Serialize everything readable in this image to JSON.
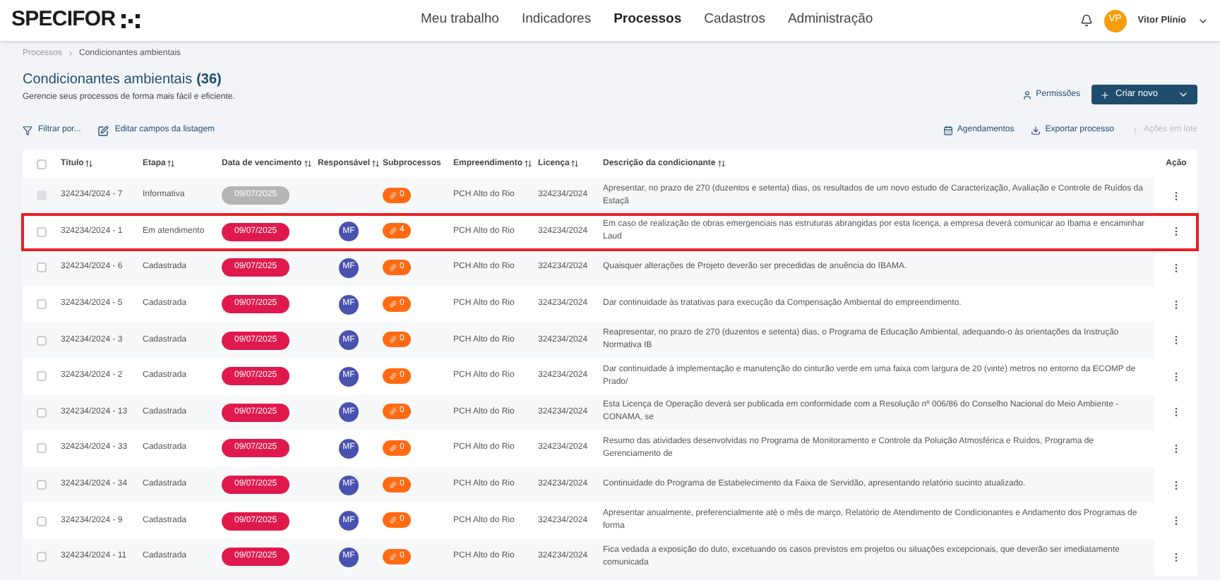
{
  "header": {
    "logo": "SPECIFOR",
    "nav": [
      {
        "label": "Meu trabalho",
        "selected": false
      },
      {
        "label": "Indicadores",
        "selected": false
      },
      {
        "label": "Processos",
        "selected": true
      },
      {
        "label": "Cadastros",
        "selected": false
      },
      {
        "label": "Administração",
        "selected": false
      }
    ],
    "user": {
      "initials": "VP",
      "name": "Vitor Plínio"
    }
  },
  "breadcrumb": [
    "Processos",
    "Condicionantes ambientais"
  ],
  "page": {
    "title": "Condicionantes ambientais",
    "count": "(36)",
    "subtitle": "Gerencie seus processos de forma mais fácil e eficiente.",
    "permissions": "Permissões",
    "create": "Criar novo"
  },
  "toolbar": {
    "left": [
      "Filtrar por...",
      "Editar campos da listagem"
    ],
    "right": [
      {
        "label": "Agendamentos",
        "disabled": false
      },
      {
        "label": "Exportar processo",
        "disabled": false
      },
      {
        "label": "Ações em lote",
        "disabled": true
      }
    ]
  },
  "table": {
    "select_all_checked": false,
    "columns": [
      {
        "label": "Título",
        "sortable": true
      },
      {
        "label": "Etapa",
        "sortable": true
      },
      {
        "label": "Data de vencimento",
        "sortable": true
      },
      {
        "label": "Responsável",
        "sortable": true
      },
      {
        "label": "Subprocessos",
        "sortable": false
      },
      {
        "label": "Empreendimento",
        "sortable": true
      },
      {
        "label": "Licença",
        "sortable": true
      },
      {
        "label": "Descrição da condicionante",
        "sortable": true
      },
      {
        "label": "Ação",
        "sortable": false
      }
    ],
    "rows": [
      {
        "title": "324234/2024 - 7",
        "stage": "Informativa",
        "due": "09/07/2025",
        "overdue": false,
        "disabled": true,
        "highlighted": false,
        "subprocesses": "0",
        "project": "PCH Alto do Rio",
        "license": "324234/2024",
        "description": "Apresentar, no prazo de 270 (duzentos e setenta) dias, os resultados de um novo estudo de Caracterização, Avaliação e Controle de Ruídos da Estaçã"
      },
      {
        "title": "324234/2024 - 1",
        "stage": "Em atendimento",
        "due": "09/07/2025",
        "overdue": true,
        "disabled": false,
        "highlighted": true,
        "owner": "MF",
        "subprocesses": "4",
        "project": "PCH Alto do Rio",
        "license": "324234/2024",
        "description": "Em caso de realização de obras emergenciais nas estruturas abrangidas por esta licença, a empresa deverá comunicar ao Ibama e encaminhar Laud"
      },
      {
        "title": "324234/2024 - 6",
        "stage": "Cadastrada",
        "due": "09/07/2025",
        "overdue": true,
        "disabled": false,
        "highlighted": false,
        "owner": "MF",
        "subprocesses": "0",
        "project": "PCH Alto do Rio",
        "license": "324234/2024",
        "description": "Quaisquer alterações de Projeto deverão ser precedidas de anuência do IBAMA."
      },
      {
        "title": "324234/2024 - 5",
        "stage": "Cadastrada",
        "due": "09/07/2025",
        "overdue": true,
        "disabled": false,
        "highlighted": false,
        "owner": "MF",
        "subprocesses": "0",
        "project": "PCH Alto do Rio",
        "license": "324234/2024",
        "description": "Dar continuidade às tratativas para execução da Compensação Ambiental do empreendimento."
      },
      {
        "title": "324234/2024 - 3",
        "stage": "Cadastrada",
        "due": "09/07/2025",
        "overdue": true,
        "disabled": false,
        "highlighted": false,
        "owner": "MF",
        "subprocesses": "0",
        "project": "PCH Alto do Rio",
        "license": "324234/2024",
        "description": "Reapresentar, no prazo de 270 (duzentos e setenta) dias, o Programa de Educação Ambiental, adequando-o às orientações da Instrução Normativa IB"
      },
      {
        "title": "324234/2024 - 2",
        "stage": "Cadastrada",
        "due": "09/07/2025",
        "overdue": true,
        "disabled": false,
        "highlighted": false,
        "owner": "MF",
        "subprocesses": "0",
        "project": "PCH Alto do Rio",
        "license": "324234/2024",
        "description": "Dar continuidade à implementação e manutenção do cinturão verde em uma faixa com largura de 20 (vinte) metros no entorno da ECOMP de Prado/"
      },
      {
        "title": "324234/2024 - 13",
        "stage": "Cadastrada",
        "due": "09/07/2025",
        "overdue": true,
        "disabled": false,
        "highlighted": false,
        "owner": "MF",
        "subprocesses": "0",
        "project": "PCH Alto do Rio",
        "license": "324234/2024",
        "description": "Esta Licença de Operação deverá ser publicada em conformidade com a Resolução nº 006/86 do Conselho Nacional do Meio Ambiente - CONAMA, se"
      },
      {
        "title": "324234/2024 - 33",
        "stage": "Cadastrada",
        "due": "09/07/2025",
        "overdue": true,
        "disabled": false,
        "highlighted": false,
        "owner": "MF",
        "subprocesses": "0",
        "project": "PCH Alto do Rio",
        "license": "324234/2024",
        "description": "Resumo das atividades desenvolvidas no Programa de Monitoramento e Controle da Poluição Atmosférica e Ruídos, Programa de Gerenciamento de"
      },
      {
        "title": "324234/2024 - 34",
        "stage": "Cadastrada",
        "due": "09/07/2025",
        "overdue": true,
        "disabled": false,
        "highlighted": false,
        "owner": "MF",
        "subprocesses": "0",
        "project": "PCH Alto do Rio",
        "license": "324234/2024",
        "description": "Continuidade do Programa de Estabelecimento da Faixa de Servidão, apresentando relatório sucinto atualizado."
      },
      {
        "title": "324234/2024 - 9",
        "stage": "Cadastrada",
        "due": "09/07/2025",
        "overdue": true,
        "disabled": false,
        "highlighted": false,
        "owner": "MF",
        "subprocesses": "0",
        "project": "PCH Alto do Rio",
        "license": "324234/2024",
        "description": "Apresentar anualmente, preferencialmente até o mês de março, Relatório de Atendimento de Condicionantes e Andamento dos Programas de forma"
      },
      {
        "title": "324234/2024 - 11",
        "stage": "Cadastrada",
        "due": "09/07/2025",
        "overdue": true,
        "disabled": false,
        "highlighted": false,
        "owner": "MF",
        "subprocesses": "0",
        "project": "PCH Alto do Rio",
        "license": "324234/2024",
        "description": "Fica vedada a exposição do duto, excetuando os casos previstos em projetos ou situações excepcionais, que deverão ser imediatamente comunicada"
      }
    ]
  }
}
